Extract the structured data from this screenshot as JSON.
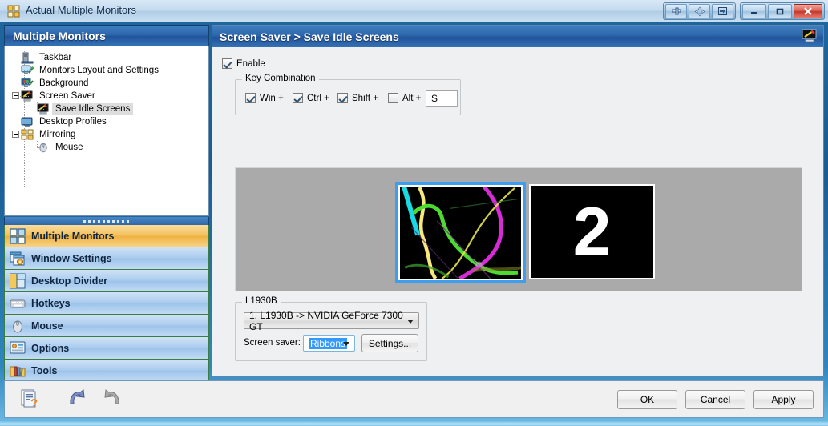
{
  "window": {
    "title": "Actual Multiple Monitors",
    "icon": "app-monitors-icon",
    "buttons": {
      "pin": "pin-to-top-button",
      "move": "move-to-monitor-button",
      "rollup": "send-to-monitor-button",
      "minimize": "–",
      "maximize": "❐",
      "close": "✕"
    }
  },
  "sidebar": {
    "header": "Multiple Monitors",
    "tree": [
      {
        "label": "Taskbar",
        "icon": "taskbar-icon",
        "indent": 1,
        "selected": false,
        "expander": null
      },
      {
        "label": "Monitors Layout and Settings",
        "icon": "monitors-layout-icon",
        "indent": 1,
        "selected": false,
        "expander": null
      },
      {
        "label": "Background",
        "icon": "background-icon",
        "indent": 1,
        "selected": false,
        "expander": null
      },
      {
        "label": "Screen Saver",
        "icon": "screen-saver-icon",
        "indent": 1,
        "selected": false,
        "expander": "collapse"
      },
      {
        "label": "Save Idle Screens",
        "icon": "screen-saver-icon",
        "indent": 2,
        "selected": true,
        "expander": null
      },
      {
        "label": "Desktop Profiles",
        "icon": "desktop-profiles-icon",
        "indent": 1,
        "selected": false,
        "expander": null
      },
      {
        "label": "Mirroring",
        "icon": "mirroring-icon",
        "indent": 1,
        "selected": false,
        "expander": "collapse"
      },
      {
        "label": "Mouse",
        "icon": "mouse-icon",
        "indent": 2,
        "selected": false,
        "expander": null
      }
    ],
    "nav": [
      {
        "label": "Multiple Monitors",
        "icon": "multiple-monitors-icon",
        "active": true
      },
      {
        "label": "Window Settings",
        "icon": "window-settings-icon",
        "active": false
      },
      {
        "label": "Desktop Divider",
        "icon": "desktop-divider-icon",
        "active": false
      },
      {
        "label": "Hotkeys",
        "icon": "keyboard-icon",
        "active": false
      },
      {
        "label": "Mouse",
        "icon": "mouse-icon",
        "active": false
      },
      {
        "label": "Options",
        "icon": "options-icon",
        "active": false
      },
      {
        "label": "Tools",
        "icon": "tools-icon",
        "active": false
      }
    ],
    "expand_more": "»"
  },
  "main": {
    "header": "Screen Saver > Save Idle Screens",
    "header_icon": "screen-saver-icon",
    "enable": {
      "label": "Enable",
      "checked": true
    },
    "key_combination": {
      "caption": "Key Combination",
      "modifiers": [
        {
          "label": "Win +",
          "checked": true
        },
        {
          "label": "Ctrl +",
          "checked": true
        },
        {
          "label": "Shift +",
          "checked": true
        },
        {
          "label": "Alt +",
          "checked": false
        }
      ],
      "key_value": "S"
    },
    "preview": {
      "monitors": [
        {
          "id": 1,
          "selected": true,
          "content": "ribbons-screensaver-preview"
        },
        {
          "id": 2,
          "selected": false,
          "content": "2"
        }
      ]
    },
    "monitor_group": {
      "caption": "L1930B",
      "device_selected": "1. L1930B -> NVIDIA GeForce 7300 GT",
      "screen_saver_label": "Screen saver:",
      "screen_saver_selected": "Ribbons",
      "settings_label": "Settings..."
    }
  },
  "footer": {
    "help_icon": "help-icon",
    "undo_icon": "undo-icon",
    "redo_icon": "redo-icon",
    "ok": "OK",
    "cancel": "Cancel",
    "apply": "Apply"
  }
}
